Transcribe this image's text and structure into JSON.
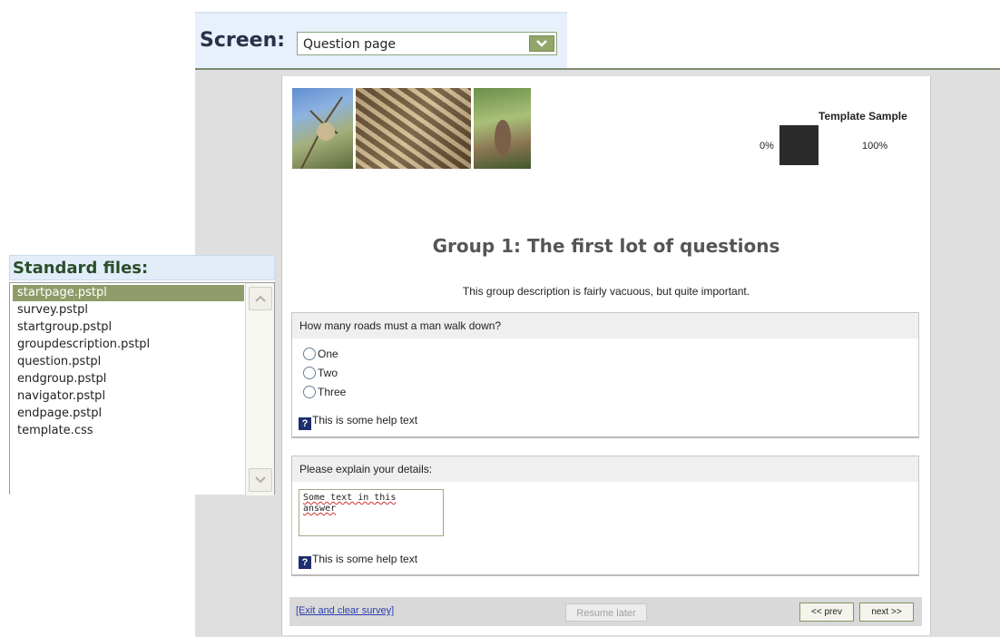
{
  "screen": {
    "label": "Screen:",
    "selected": "Question page"
  },
  "template": {
    "title": "Template Sample",
    "progress_min": "0%",
    "progress_max": "100%",
    "progress_value": 0
  },
  "group": {
    "title": "Group 1: The first lot of questions",
    "description": "This group description is fairly vacuous, but quite important."
  },
  "question1": {
    "text": "How many roads must a man walk down?",
    "options": [
      "One",
      "Two",
      "Three"
    ],
    "help": "This is some help text"
  },
  "question2": {
    "text": "Please explain your details:",
    "answer_line1": "Some text in this",
    "answer_line2": "answer",
    "help": "This is some help text"
  },
  "navigation": {
    "exit": "[Exit and clear survey]",
    "resume": "Resume later",
    "prev": "<< prev",
    "next": "next >>"
  },
  "files": {
    "heading": "Standard files:",
    "items": [
      "startpage.pstpl",
      "survey.pstpl",
      "startgroup.pstpl",
      "groupdescription.pstpl",
      "question.pstpl",
      "endgroup.pstpl",
      "navigator.pstpl",
      "endpage.pstpl",
      "template.css"
    ],
    "selected_index": 0
  },
  "colors": {
    "accent_green": "#8f9c6a",
    "heading_blue_bg": "#e3edf9"
  },
  "icons": {
    "dropdown": "chevron-down-icon",
    "help": "help-question-icon",
    "scroll_up": "scroll-up-arrow-icon",
    "scroll_down": "scroll-down-arrow-icon"
  }
}
